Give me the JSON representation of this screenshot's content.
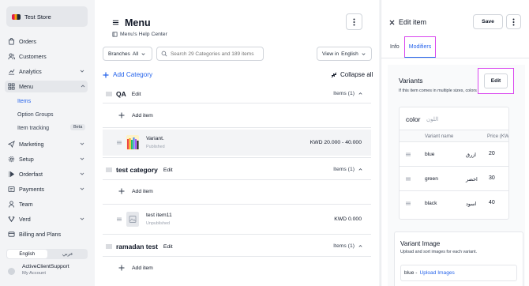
{
  "sidebar": {
    "store_name": "Test Store",
    "items": [
      {
        "label": "Orders"
      },
      {
        "label": "Customers"
      },
      {
        "label": "Analytics"
      },
      {
        "label": "Menu"
      },
      {
        "label": "Marketing"
      },
      {
        "label": "Setup"
      },
      {
        "label": "Orderfast"
      },
      {
        "label": "Payments"
      },
      {
        "label": "Team"
      },
      {
        "label": "Verd"
      },
      {
        "label": "Billing and Plans"
      }
    ],
    "menu_sub": [
      {
        "label": "Items"
      },
      {
        "label": "Option Groups"
      },
      {
        "label": "Item tracking"
      }
    ],
    "beta_badge": "Beta",
    "lang": {
      "english": "English",
      "arabic": "عربي"
    },
    "account": {
      "name": "ActiveClientSupport",
      "sub": "My Account"
    }
  },
  "main": {
    "title": "Menu",
    "help_link": "Menu's Help Center",
    "branches_label": "Branches",
    "branches_value": "All",
    "search_placeholder": "Search 29 Categories and 189 items",
    "view_in_label": "View in",
    "view_in_value": "English",
    "add_category": "Add Category",
    "collapse_all": "Collapse all",
    "categories": [
      {
        "name": "QA",
        "edit": "Edit",
        "items_count": "Items (1)",
        "add_item": "Add item",
        "item": {
          "name": "Variant.",
          "status": "Published",
          "price": "KWD 20.000 - 40.000"
        }
      },
      {
        "name": "test category",
        "edit": "Edit",
        "items_count": "Items (1)",
        "add_item": "Add item",
        "item": {
          "name": "test item11",
          "status": "Unpublished",
          "price": "KWD 0.000"
        }
      },
      {
        "name": "ramadan test",
        "edit": "Edit",
        "items_count": "Items (1)",
        "add_item": "Add item"
      }
    ]
  },
  "panel": {
    "title": "Edit item",
    "save": "Save",
    "tabs": {
      "info": "Info",
      "modifiers": "Modifiers"
    },
    "variants": {
      "title": "Variants",
      "subtitle": "If this item comes in multiple sizes, colors or shapes.",
      "edit": "Edit",
      "group_name": "color",
      "group_name_ar": "اللون",
      "col_name": "Variant name",
      "col_price": "Price (KW",
      "rows": [
        {
          "en": "blue",
          "ar": "ازرق",
          "price": "20"
        },
        {
          "en": "green",
          "ar": "اخضر",
          "price": "30"
        },
        {
          "en": "black",
          "ar": "اسود",
          "price": "40"
        }
      ]
    },
    "variant_image": {
      "title": "Variant Image",
      "subtitle": "Upload and sort images for each variant.",
      "row_label": "blue -",
      "upload_link": "Upload Images"
    }
  },
  "colors": {
    "accent": "#2563eb",
    "highlight": "#d946ef",
    "sidebar_bg": "#f3f4f6"
  }
}
